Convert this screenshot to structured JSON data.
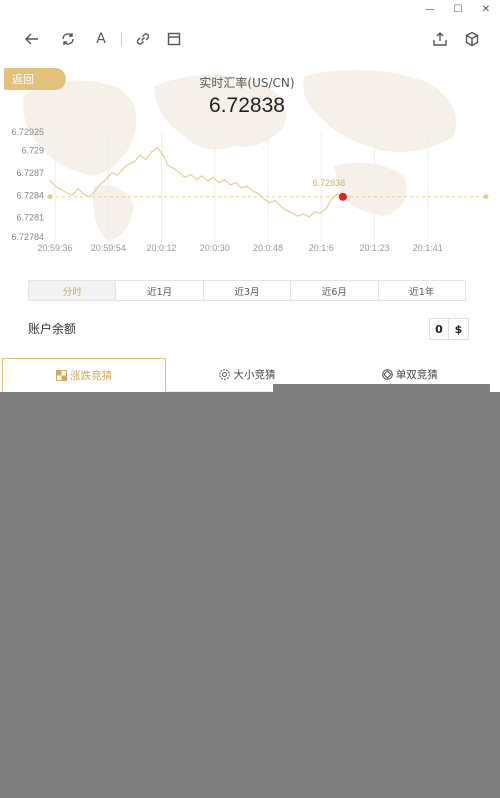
{
  "window": {
    "minimize": "—",
    "maximize": "☐",
    "close": "✕"
  },
  "toolbar": {
    "back": "arrow-left-icon",
    "refresh": "refresh-icon",
    "text": "A",
    "link": "link-icon",
    "layout": "layout-icon",
    "share": "share-icon",
    "cube": "cube-icon"
  },
  "header": {
    "back_label": "返回",
    "title": "实时汇率(US/CN)",
    "rate": "6.72838"
  },
  "chart_data": {
    "type": "line",
    "x": [
      "20:59:36",
      "20:59:54",
      "20:0:12",
      "20:0:30",
      "20:0:48",
      "20:1:6",
      "20:1:23",
      "20:1:41"
    ],
    "y_ticks": [
      "6.72925",
      "6.729",
      "6.7287",
      "6.7284",
      "6.7281",
      "6.72784"
    ],
    "ylim": [
      6.72784,
      6.72925
    ],
    "current_value": 6.72838,
    "current_label": "6.72838",
    "series": [
      {
        "values": [
          6.7286,
          6.72852,
          6.72848,
          6.72843,
          6.7284,
          6.72849,
          6.72841,
          6.72838,
          6.72846,
          6.72855,
          6.72862,
          6.7287,
          6.72867,
          6.72876,
          6.72882,
          6.72885,
          6.72894,
          6.72888,
          6.72898,
          6.72904,
          6.72895,
          6.7288,
          6.72876,
          6.7287,
          6.72864,
          6.72868,
          6.72861,
          6.72866,
          6.72859,
          6.72864,
          6.72857,
          6.72861,
          6.72854,
          6.72857,
          6.7285,
          6.72852,
          6.72846,
          6.72842,
          6.72835,
          6.7283,
          6.72833,
          6.72825,
          6.7282,
          6.72816,
          6.72812,
          6.72815,
          6.72811,
          6.72818,
          6.72816,
          6.72822,
          6.72835,
          6.72842,
          6.72838
        ]
      }
    ],
    "line_color": "#e3cf9a",
    "marker_color": "#e02020",
    "grid": true
  },
  "tabs": [
    "分时",
    "近1月",
    "近3月",
    "近6月",
    "近1年"
  ],
  "balance": {
    "label": "账户余额",
    "amount": "0",
    "currency": "$"
  },
  "game_tabs": [
    {
      "label": "涨跌竞猜",
      "icon": "grid-icon"
    },
    {
      "label": "大小竞猜",
      "icon": "flower-icon"
    },
    {
      "label": "单双竞猜",
      "icon": "diamond-icon"
    }
  ]
}
